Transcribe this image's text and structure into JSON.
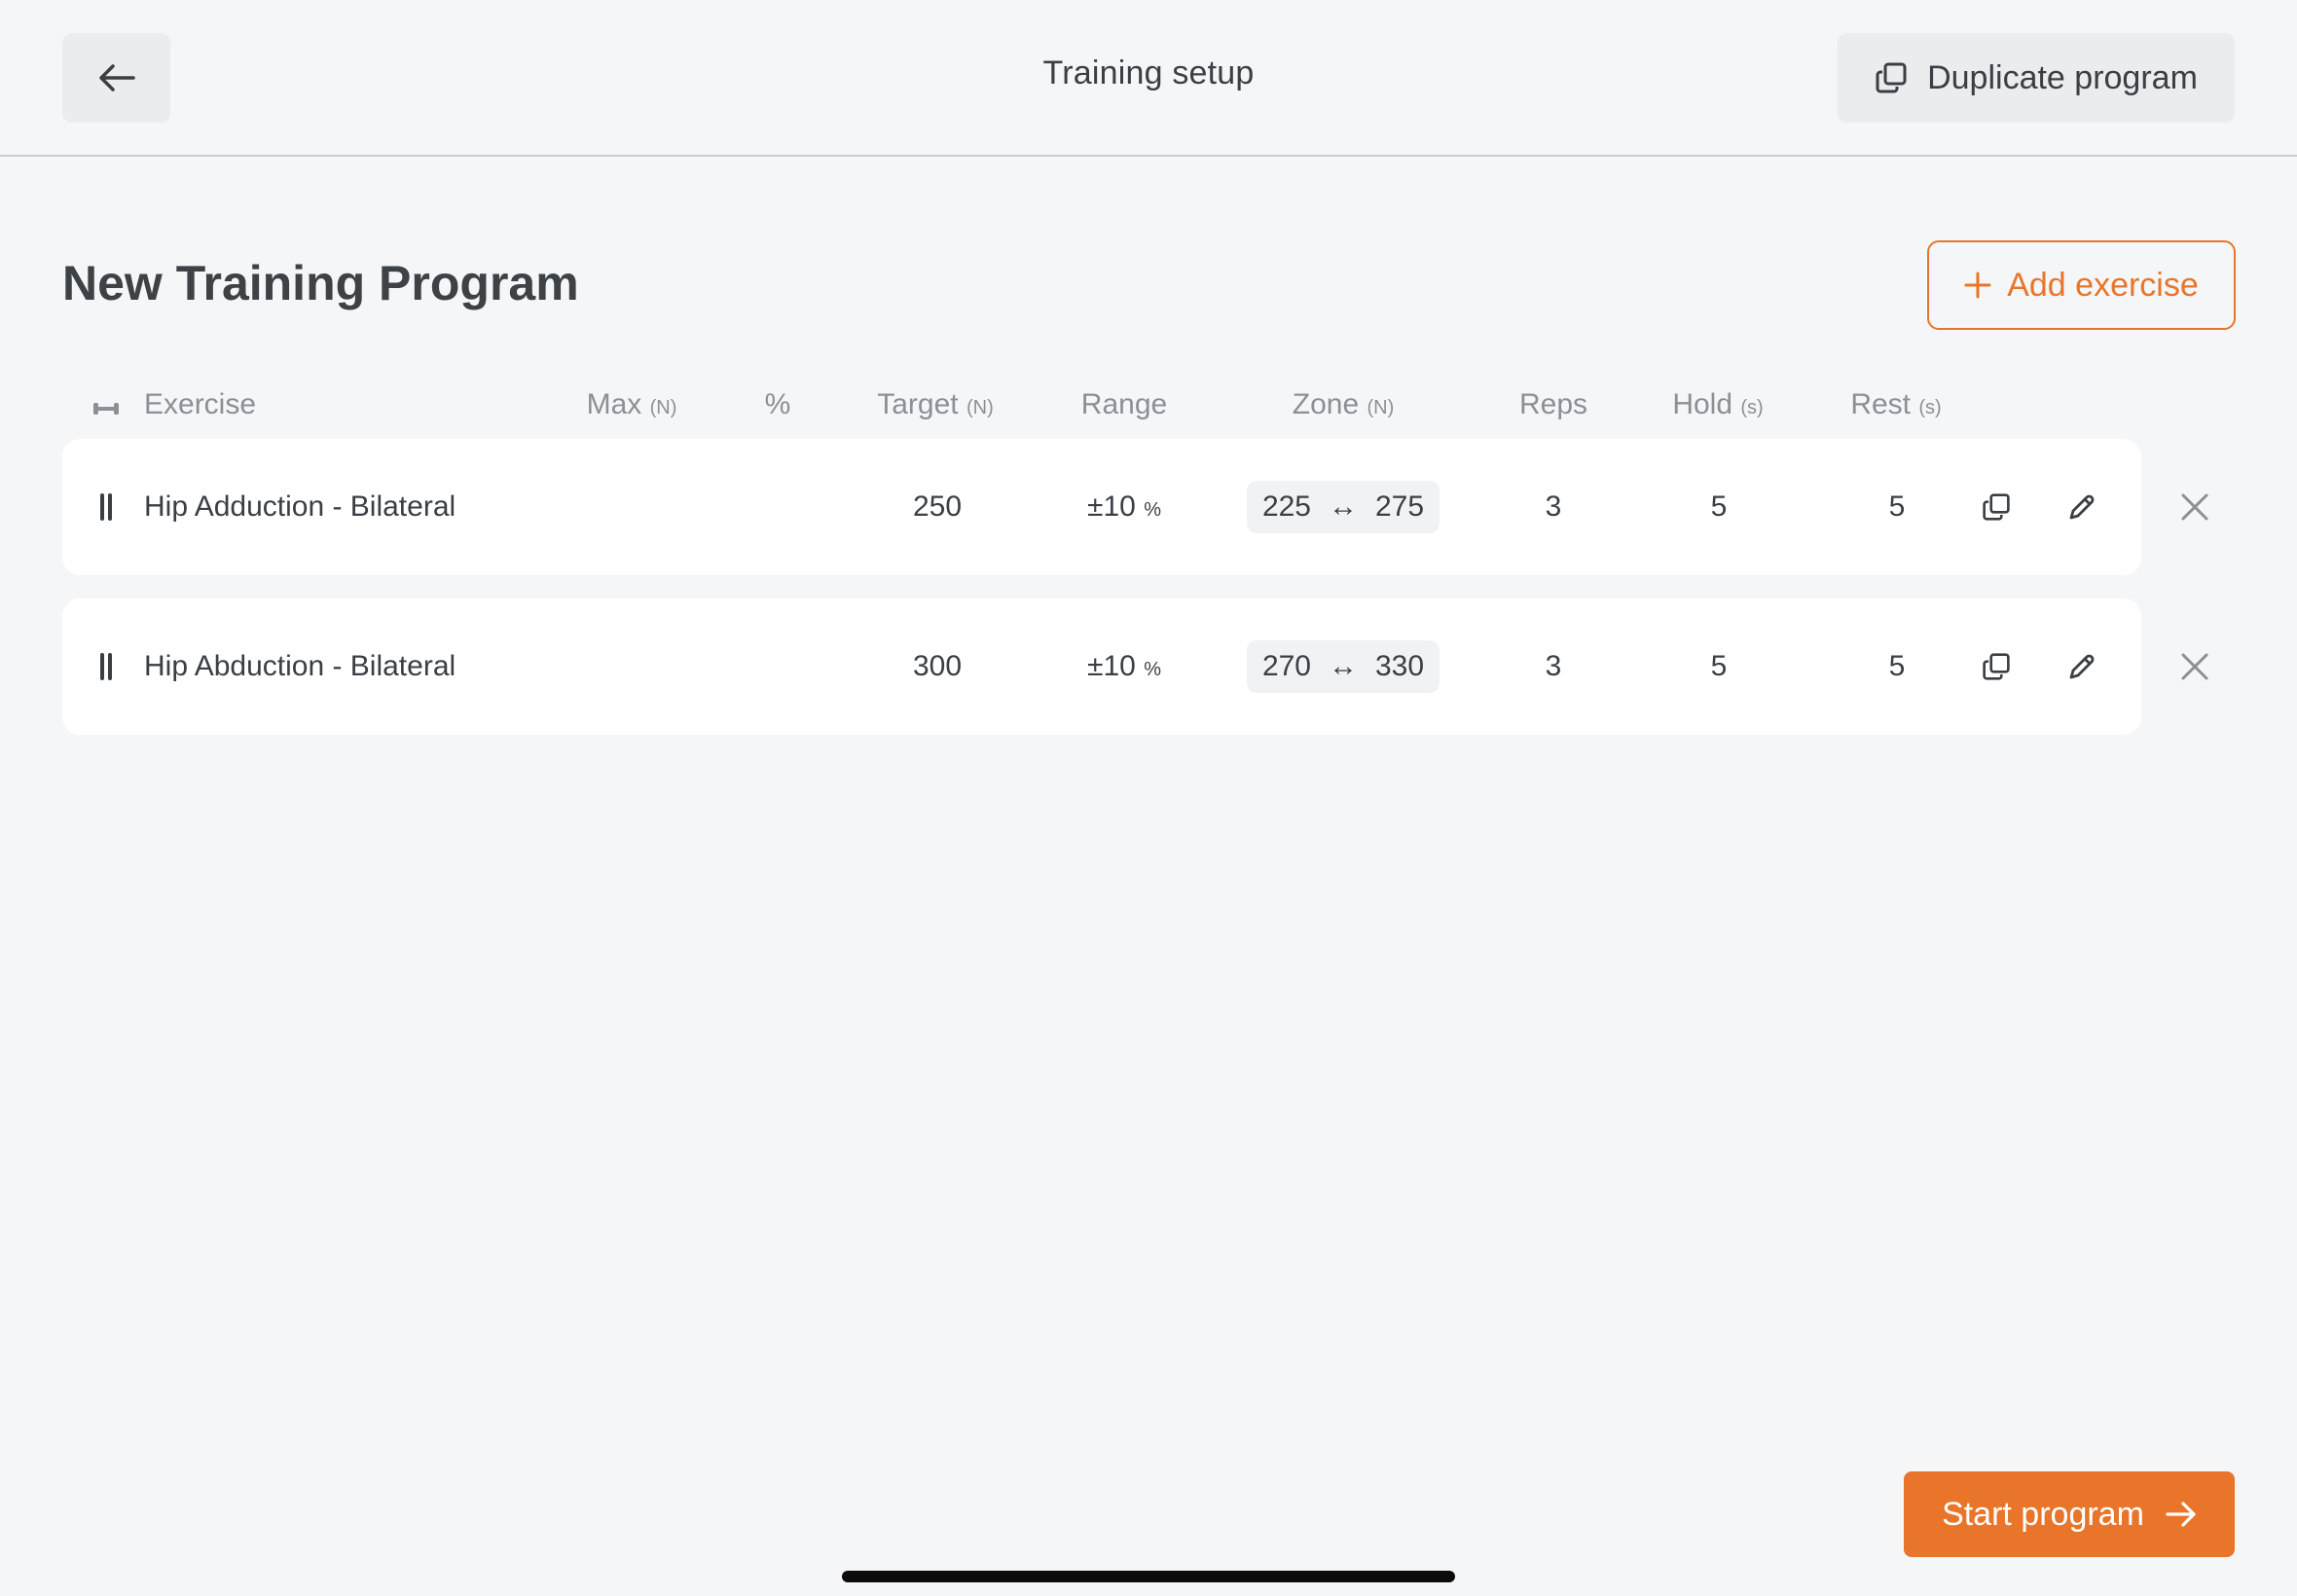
{
  "topbar": {
    "title": "Training setup",
    "back_icon": "arrow-left-icon",
    "duplicate_label": "Duplicate program",
    "duplicate_icon": "copy-icon"
  },
  "program": {
    "title": "New Training Program",
    "add_label": "Add exercise",
    "add_icon": "plus-icon"
  },
  "columns": {
    "exercise": "Exercise",
    "max": "Max",
    "max_unit": "(N)",
    "percent": "%",
    "target": "Target",
    "target_unit": "(N)",
    "range": "Range",
    "zone": "Zone",
    "zone_unit": "(N)",
    "reps": "Reps",
    "hold": "Hold",
    "hold_unit": "(s)",
    "rest": "Rest",
    "rest_unit": "(s)"
  },
  "exercises": [
    {
      "name": "Hip Adduction - Bilateral",
      "max": "",
      "percent": "",
      "target": "250",
      "range_sign": "±",
      "range_value": "10",
      "range_unit": "%",
      "zone_low": "225",
      "zone_arrow": "↔",
      "zone_high": "275",
      "reps": "3",
      "hold": "5",
      "rest": "5"
    },
    {
      "name": "Hip Abduction - Bilateral",
      "max": "",
      "percent": "",
      "target": "300",
      "range_sign": "±",
      "range_value": "10",
      "range_unit": "%",
      "zone_low": "270",
      "zone_arrow": "↔",
      "zone_high": "330",
      "reps": "3",
      "hold": "5",
      "rest": "5"
    }
  ],
  "footer": {
    "start_label": "Start program",
    "start_icon": "arrow-right-icon"
  },
  "colors": {
    "accent": "#e8752a",
    "background": "#f5f6f7",
    "row_bg": "#ffffff",
    "text": "#3a3f45",
    "muted": "#8b9097"
  }
}
